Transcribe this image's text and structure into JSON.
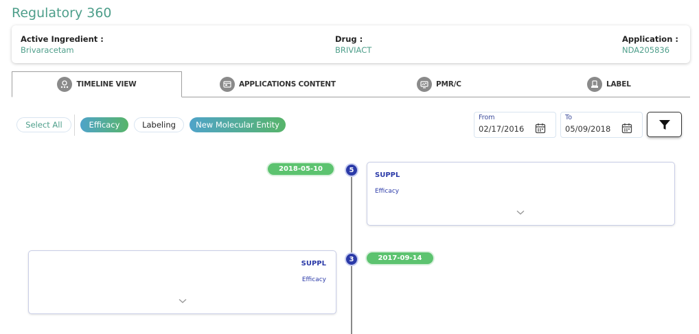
{
  "app": {
    "title": "Regulatory 360"
  },
  "info": {
    "active_ingredient_label": "Active Ingredient :",
    "active_ingredient_value": "Brivaracetam",
    "drug_label": "Drug :",
    "drug_value": "BRIVIACT",
    "application_label": "Application :",
    "application_value": "NDA205836"
  },
  "tabs": [
    {
      "label": "TIMELINE VIEW",
      "icon": "timeline-icon",
      "active": true
    },
    {
      "label": "APPLICATIONS CONTENT",
      "icon": "applications-icon",
      "active": false
    },
    {
      "label": "PMR/C",
      "icon": "monitor-icon",
      "active": false
    },
    {
      "label": "LABEL",
      "icon": "label-icon",
      "active": false
    }
  ],
  "filters": {
    "select_all": "Select All",
    "chips": [
      {
        "label": "Efficacy",
        "selected": true
      },
      {
        "label": "Labeling",
        "selected": false
      },
      {
        "label": "New Molecular Entity",
        "selected": true
      }
    ]
  },
  "date_range": {
    "from_label": "From",
    "from_value": "02/17/2016",
    "to_label": "To",
    "to_value": "05/09/2018"
  },
  "timeline": [
    {
      "date": "2018-05-10",
      "number": "5",
      "type": "SUPPL",
      "category": "Efficacy"
    },
    {
      "date": "2017-09-14",
      "number": "3",
      "type": "SUPPL",
      "category": "Efficacy"
    }
  ],
  "colors": {
    "brand_teal": "#4d9e8a",
    "node_blue": "#2b3aa8",
    "pill_green": "#5cc36f"
  }
}
